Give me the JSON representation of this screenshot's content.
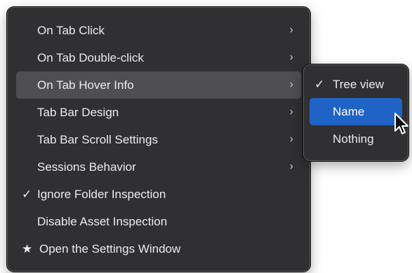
{
  "menu": {
    "items": [
      {
        "label": "On Tab Click",
        "arrow": "›",
        "mark": ""
      },
      {
        "label": "On Tab Double-click",
        "arrow": "›",
        "mark": ""
      },
      {
        "label": "On Tab Hover Info",
        "arrow": "›",
        "mark": ""
      },
      {
        "label": "Tab Bar Design",
        "arrow": "›",
        "mark": ""
      },
      {
        "label": "Tab Bar Scroll Settings",
        "arrow": "›",
        "mark": ""
      },
      {
        "label": "Sessions Behavior",
        "arrow": "›",
        "mark": ""
      },
      {
        "label": "Ignore Folder Inspection",
        "arrow": "",
        "mark": "✓"
      },
      {
        "label": "Disable Asset Inspection",
        "arrow": "",
        "mark": ""
      },
      {
        "label": "Open the Settings Window",
        "arrow": "",
        "mark": "★"
      }
    ]
  },
  "submenu": {
    "items": [
      {
        "label": "Tree view",
        "mark": "✓"
      },
      {
        "label": "Name",
        "mark": ""
      },
      {
        "label": "Nothing",
        "mark": ""
      }
    ]
  },
  "colors": {
    "menu_background": "#302f31",
    "hover_background": "#4f4e51",
    "selected_background": "#1f63c6",
    "text": "#ececec"
  },
  "icons": {
    "submenu_arrow": "chevron-right-icon",
    "check": "checkmark-icon",
    "star": "star-icon",
    "cursor": "arrow-cursor-icon"
  }
}
